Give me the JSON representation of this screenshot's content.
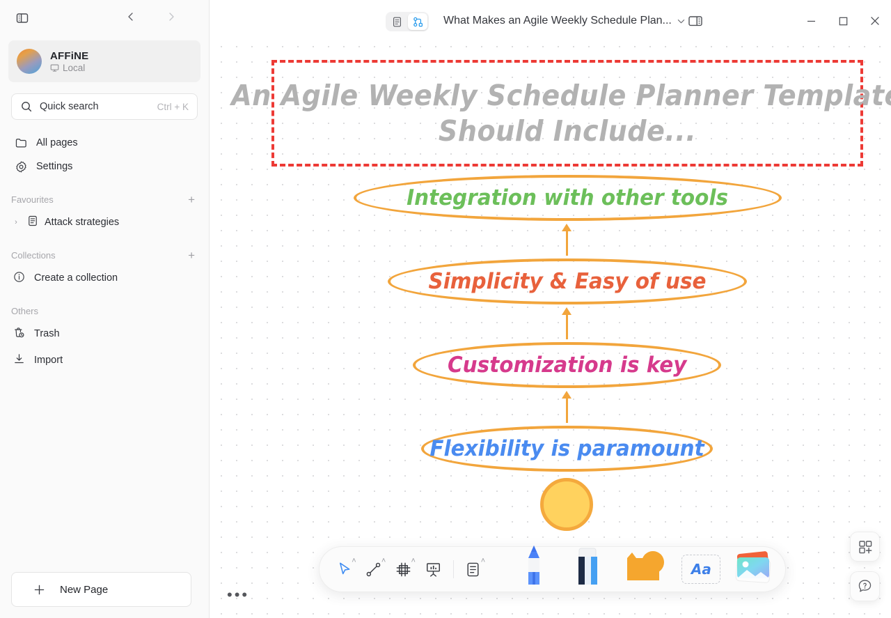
{
  "sidebar": {
    "toggle_icon": "sidebar-toggle-icon",
    "nav_back_icon": "chevron-left-icon",
    "nav_forward_icon": "chevron-right-icon",
    "workspace": {
      "name": "AFFiNE",
      "sub_label": "Local",
      "sub_icon": "monitor-icon"
    },
    "quick_search": {
      "label": "Quick search",
      "shortcut": "Ctrl + K",
      "icon": "search-icon"
    },
    "nav_items": [
      {
        "label": "All pages",
        "icon": "folder-icon"
      },
      {
        "label": "Settings",
        "icon": "gear-icon"
      }
    ],
    "sections": [
      {
        "title": "Favourites",
        "add_label": "+",
        "items": [
          {
            "label": "Attack strategies",
            "icon": "doc-icon",
            "chevron": "›"
          }
        ]
      },
      {
        "title": "Collections",
        "add_label": "+",
        "items": [
          {
            "label": "Create a collection",
            "icon": "info-icon"
          }
        ]
      },
      {
        "title": "Others",
        "items": [
          {
            "label": "Trash",
            "icon": "trash-icon"
          },
          {
            "label": "Import",
            "icon": "import-icon"
          }
        ]
      }
    ],
    "new_page": {
      "label": "New Page",
      "icon": "plus-icon"
    }
  },
  "titlebar": {
    "mode_page": {
      "icon": "page-mode-icon",
      "active": false
    },
    "mode_edgeless": {
      "icon": "edgeless-mode-icon",
      "active": true
    },
    "doc_title": "What Makes an Agile Weekly Schedule Plan...",
    "title_dropdown_icon": "chevron-down-icon",
    "right_panel_icon": "right-sidebar-icon",
    "window": {
      "minimize": "─",
      "maximize": "□",
      "close": "✕"
    }
  },
  "canvas": {
    "title_box": {
      "lines": [
        "An Agile Weekly Schedule Planner Template",
        "Should Include..."
      ],
      "border_color": "#ed3a35"
    },
    "nodes": [
      {
        "label": "Integration with other tools",
        "color": "#6cbf5a",
        "stroke": "#f2a53c"
      },
      {
        "label": "Simplicity & Easy of use",
        "color": "#e8613c",
        "stroke": "#f2a53c"
      },
      {
        "label": "Customization is key",
        "color": "#d63a8c",
        "stroke": "#f2a53c"
      },
      {
        "label": "Flexibility is paramount",
        "color": "#4a8bf0",
        "stroke": "#f2a53c"
      }
    ],
    "shape_circle": {
      "fill": "#ffd25e",
      "stroke": "#f4a93d"
    },
    "more_dots": "•••"
  },
  "toolbar": {
    "items": [
      {
        "name": "select-tool",
        "icon": "cursor-icon",
        "caret": "˄",
        "active": true
      },
      {
        "name": "connector-tool",
        "icon": "connector-icon",
        "caret": "˄",
        "active": false
      },
      {
        "name": "frame-tool",
        "icon": "frame-icon",
        "caret": "˄",
        "active": false
      },
      {
        "name": "present-tool",
        "icon": "presentation-icon",
        "caret": "",
        "active": false
      },
      {
        "name": "note-tool",
        "icon": "note-icon",
        "caret": "˄",
        "active": false
      }
    ],
    "media_items": [
      {
        "name": "pen-tool",
        "icon": "pencil-icon"
      },
      {
        "name": "eraser-tool",
        "icon": "eraser-icon"
      },
      {
        "name": "shape-tool",
        "icon": "shape-icon"
      },
      {
        "name": "text-tool",
        "icon": "text-aa-icon",
        "label": "Aa"
      },
      {
        "name": "image-tool",
        "icon": "image-icon"
      }
    ]
  },
  "float_buttons": [
    {
      "name": "template-button",
      "icon": "grid-plus-icon"
    },
    {
      "name": "help-button",
      "icon": "help-chat-icon"
    }
  ]
}
